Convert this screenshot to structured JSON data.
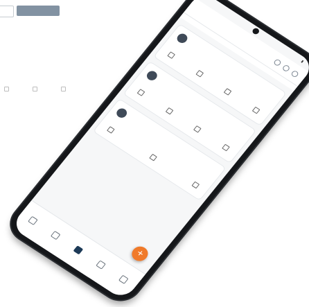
{
  "background": {
    "outline_button": "",
    "primary_button": "",
    "title": "",
    "lines": [
      "",
      ""
    ],
    "tabs": [
      "",
      "",
      ""
    ]
  },
  "phone": {
    "status_time": "",
    "header_title": "",
    "subtabs": [
      "",
      "",
      ""
    ],
    "cards": [
      {
        "initials": "",
        "name": "",
        "email": "",
        "phone": "",
        "actions": [
          "",
          "",
          "",
          ""
        ]
      },
      {
        "initials": "",
        "name": "",
        "email": "",
        "phone": "",
        "actions": [
          "",
          "",
          "",
          ""
        ]
      },
      {
        "initials": "",
        "name": "",
        "email": "",
        "phone": "",
        "actions": [
          "",
          "",
          ""
        ]
      }
    ],
    "fab_label": "+",
    "nav": [
      "",
      "",
      "",
      "",
      ""
    ]
  },
  "colors": {
    "primary": "#1d3a57",
    "accent": "#f07a2a",
    "phone_body": "#15171a"
  }
}
